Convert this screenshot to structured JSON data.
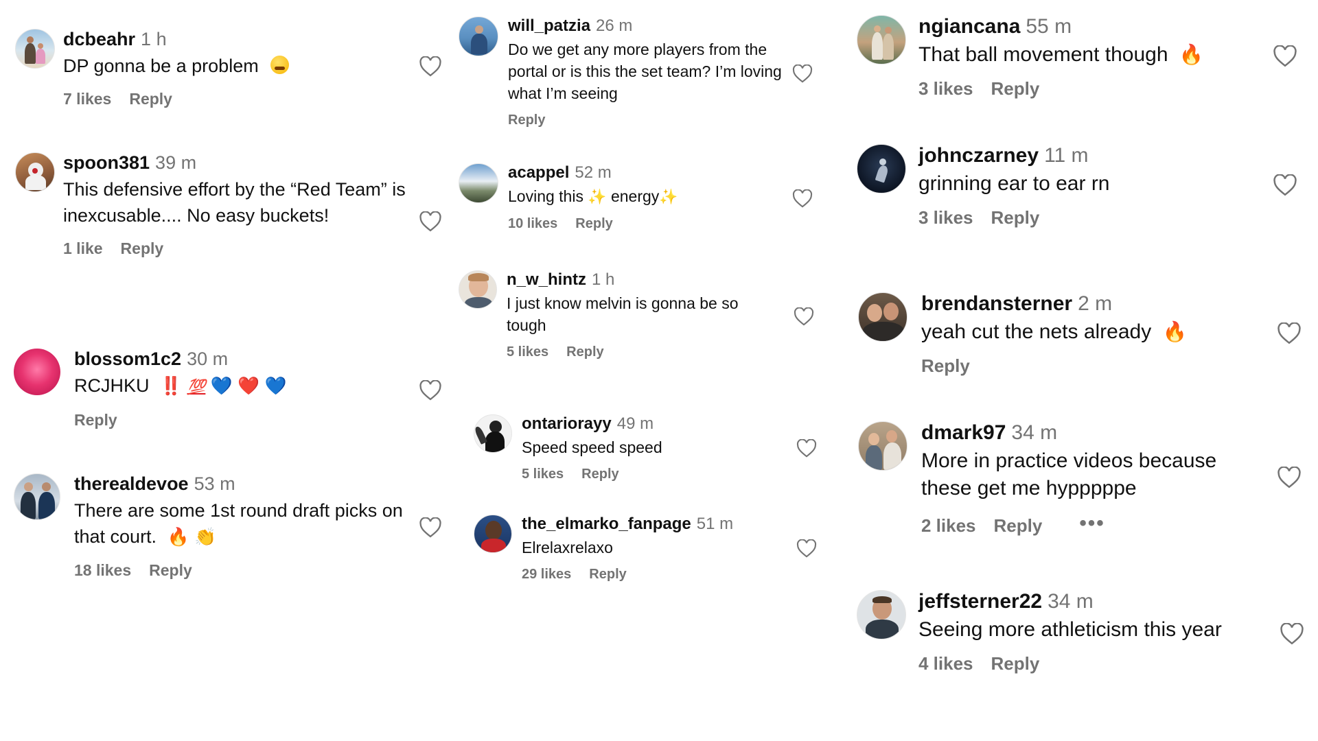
{
  "comments": [
    {
      "username": "dcbeahr",
      "time": "1 h",
      "text": "DP gonna be a problem",
      "emojis": [
        "face-steam-icon"
      ],
      "likes": "7 likes",
      "reply": "Reply"
    },
    {
      "username": "spoon381",
      "time": "39 m",
      "text": "This defensive effort by the “Red Team” is inexcusable.... No easy buckets!",
      "likes": "1 like",
      "reply": "Reply"
    },
    {
      "username": "blossom1c2",
      "time": "30 m",
      "text": "RCJHKU",
      "emojis": [
        "‼️",
        "💯",
        "💙",
        "❤️",
        "💙"
      ],
      "reply": "Reply"
    },
    {
      "username": "therealdevoe",
      "time": "53 m",
      "text": "There are some 1st round draft picks on that court.",
      "emojis": [
        "🔥",
        "👏"
      ],
      "likes": "18 likes",
      "reply": "Reply"
    },
    {
      "username": "will_patzia",
      "time": "26 m",
      "text": "Do we get any more players from the portal or is this the set team? I’m loving what I’m seeing",
      "reply": "Reply"
    },
    {
      "username": "acappel",
      "time": "52 m",
      "text_parts": [
        "Loving this ",
        "✨",
        " energy",
        "✨"
      ],
      "likes": "10 likes",
      "reply": "Reply"
    },
    {
      "username": "n_w_hintz",
      "time": "1 h",
      "text": "I just know melvin is gonna be so tough",
      "likes": "5 likes",
      "reply": "Reply"
    },
    {
      "username": "ontariorayy",
      "time": "49 m",
      "text": "Speed speed speed",
      "likes": "5 likes",
      "reply": "Reply"
    },
    {
      "username": "the_elmarko_fanpage",
      "time": "51 m",
      "text": "Elrelaxrelaxo",
      "likes": "29 likes",
      "reply": "Reply"
    },
    {
      "username": "ngiancana",
      "time": "55 m",
      "text": "That ball movement though",
      "emojis": [
        "🔥"
      ],
      "likes": "3 likes",
      "reply": "Reply"
    },
    {
      "username": "johnczarney",
      "time": "11 m",
      "text": "grinning ear to ear rn",
      "likes": "3 likes",
      "reply": "Reply"
    },
    {
      "username": "brendansterner",
      "time": "2 m",
      "text": "yeah cut the nets already",
      "emojis": [
        "🔥"
      ],
      "reply": "Reply"
    },
    {
      "username": "dmark97",
      "time": "34 m",
      "text": "More in practice videos because these get me hypppppe",
      "likes": "2 likes",
      "reply": "Reply",
      "more": "•••"
    },
    {
      "username": "jeffsterner22",
      "time": "34 m",
      "text": "Seeing more athleticism this year",
      "likes": "4 likes",
      "reply": "Reply"
    }
  ],
  "icons": {
    "like": "heart-outline-icon",
    "avatar": "profile-avatar-icon"
  },
  "colors": {
    "text": "#111111",
    "muted": "#737373",
    "background": "#ffffff"
  }
}
